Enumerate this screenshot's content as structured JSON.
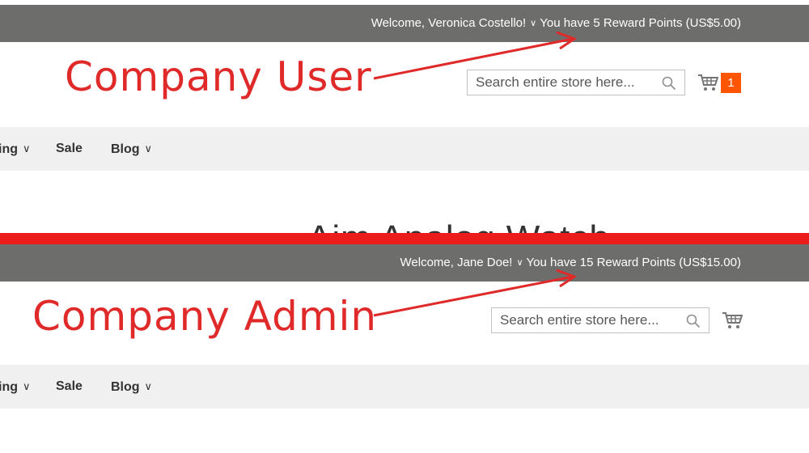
{
  "user_view": {
    "annotation": "Company User",
    "welcome_text": "Welcome, Veronica Costello!",
    "reward_text": "You have 5 Reward Points (US$5.00)",
    "search_placeholder": "Search entire store here...",
    "cart_count": "1",
    "nav": [
      "ing",
      "Sale",
      "Blog"
    ],
    "hero_title_partial": "Aim Analog Watch"
  },
  "admin_view": {
    "annotation": "Company Admin",
    "welcome_text": "Welcome, Jane Doe!",
    "reward_text": "You have 15 Reward Points (US$15.00)",
    "search_placeholder": "Search entire store here...",
    "nav": [
      "ing",
      "Sale",
      "Blog"
    ]
  },
  "icons": {
    "dropdown": "chevron-down-icon",
    "search": "magnifier-icon",
    "cart": "shopping-cart-icon"
  },
  "colors": {
    "header_bar": "#6d6e6c",
    "annotation": "#e02a2a",
    "divider": "#ec1c1c",
    "cart_counter": "#ff5501",
    "nav_bg": "#f0f0f0"
  }
}
